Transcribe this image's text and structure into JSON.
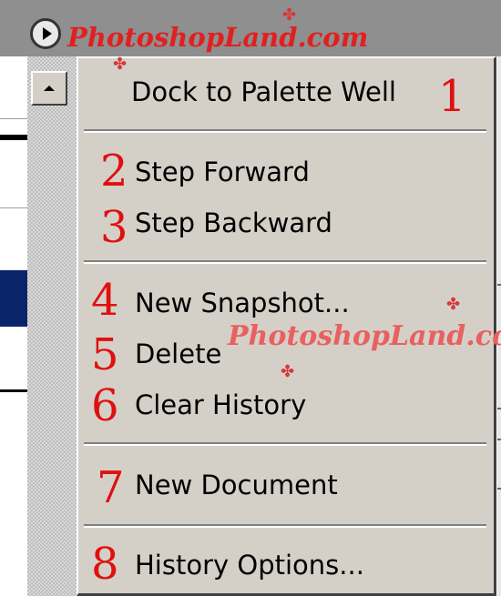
{
  "watermark": {
    "top": "PhotoshopLand.com",
    "middle": "PhotoshopLand.co"
  },
  "menu": {
    "items": [
      {
        "label": "Dock to Palette Well",
        "num": "1"
      },
      {
        "label": "Step Forward",
        "num": "2"
      },
      {
        "label": "Step Backward",
        "num": "3"
      },
      {
        "label": "New Snapshot...",
        "num": "4"
      },
      {
        "label": "Delete",
        "num": "5"
      },
      {
        "label": "Clear History",
        "num": "6"
      },
      {
        "label": "New Document",
        "num": "7"
      },
      {
        "label": "History Options...",
        "num": "8"
      }
    ]
  },
  "colors": {
    "menu_bg": "#d4d0c8",
    "annotation_red": "#e01010",
    "selection_blue": "#0a246a"
  },
  "icons": {
    "menu_button": "circle-arrow-right-icon",
    "scroll_up": "scroll-up-arrow-icon",
    "watermark_mark": "butterfly-icon"
  }
}
